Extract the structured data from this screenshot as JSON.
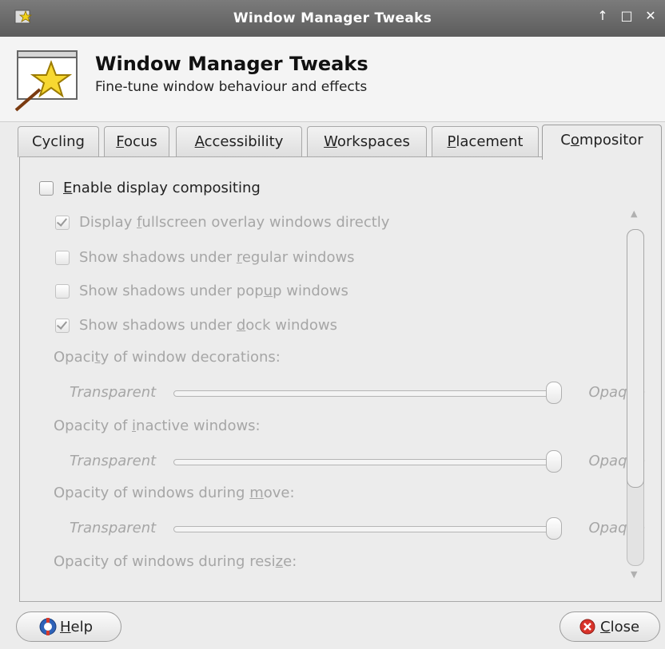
{
  "window": {
    "title": "Window Manager Tweaks"
  },
  "header": {
    "title": "Window Manager Tweaks",
    "subtitle": "Fine-tune window behaviour and effects"
  },
  "tabs": [
    {
      "pre": "Cycling",
      "u": "",
      "post": ""
    },
    {
      "pre": "",
      "u": "F",
      "post": "ocus"
    },
    {
      "pre": "",
      "u": "A",
      "post": "ccessibility"
    },
    {
      "pre": "",
      "u": "W",
      "post": "orkspaces"
    },
    {
      "pre": "",
      "u": "P",
      "post": "lacement"
    },
    {
      "pre": "C",
      "u": "o",
      "post": "mpositor"
    }
  ],
  "compositor": {
    "enable": {
      "pre": "",
      "u": "E",
      "post": "nable display compositing",
      "checked": false
    },
    "options": [
      {
        "pre": "Display ",
        "u": "f",
        "post": "ullscreen overlay windows directly",
        "checked": true
      },
      {
        "pre": "Show shadows under ",
        "u": "r",
        "post": "egular windows",
        "checked": false
      },
      {
        "pre": "Show shadows under pop",
        "u": "u",
        "post": "p windows",
        "checked": false
      },
      {
        "pre": "Show shadows under ",
        "u": "d",
        "post": "ock windows",
        "checked": true
      }
    ],
    "opacity": [
      {
        "pre": "Opaci",
        "u": "t",
        "post": "y of window decorations:"
      },
      {
        "pre": "Opacity of ",
        "u": "i",
        "post": "nactive windows:"
      },
      {
        "pre": "Opacity of windows during ",
        "u": "m",
        "post": "ove:"
      },
      {
        "pre": "Opacity of windows during resi",
        "u": "z",
        "post": "e:"
      }
    ],
    "slider_min": "Transparent",
    "slider_max": "Opaque"
  },
  "buttons": {
    "help": {
      "u": "H",
      "post": "elp"
    },
    "close": {
      "u": "C",
      "post": "lose"
    }
  }
}
